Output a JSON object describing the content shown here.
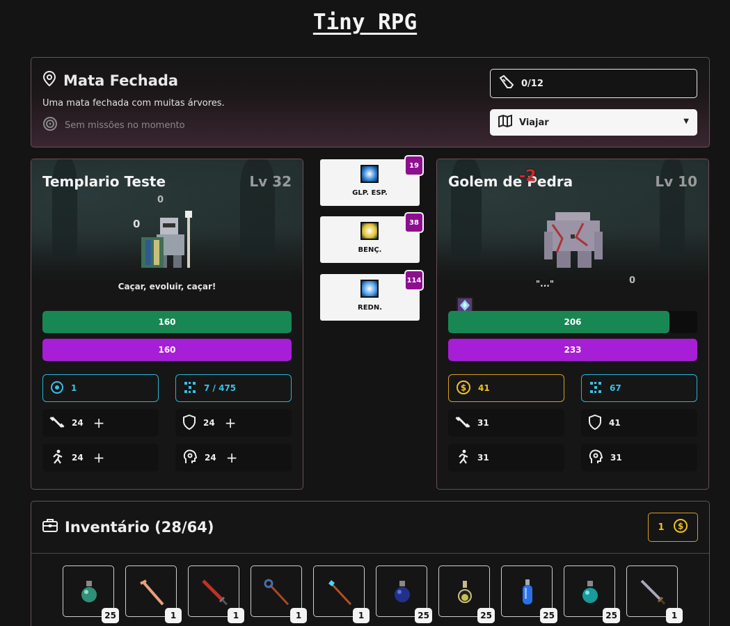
{
  "app": {
    "title": "Tiny RPG"
  },
  "location": {
    "name": "Mata Fechada",
    "description": "Uma mata fechada com muitas árvores.",
    "mission_status": "Sem missões no momento",
    "steps": "0/12",
    "travel_label": "Viajar",
    "icons": {
      "location": "map-pin-icon",
      "mission": "target-icon",
      "steps": "boot-icon",
      "travel": "map-icon"
    }
  },
  "player": {
    "name": "Templario Teste",
    "level": "Lv 32",
    "quote": "Caçar, evoluir, caçar!",
    "float_a": "0",
    "float_b": "0",
    "hp": {
      "label": "160",
      "fraction": 1.0
    },
    "mp": {
      "label": "160",
      "fraction": 1.0
    },
    "points": "1",
    "xp": "7 / 475",
    "strength": "24",
    "defense": "24",
    "agility": "24",
    "magic": "24",
    "plus": "+"
  },
  "skills": [
    {
      "label": "GLP. ESP.",
      "cost": "19",
      "color": "#2a7fd4"
    },
    {
      "label": "BENÇ.",
      "cost": "38",
      "color": "#e0c22a"
    },
    {
      "label": "REDN.",
      "cost": "114",
      "color": "#4a9be8"
    }
  ],
  "enemy": {
    "name": "Golem de Pedra",
    "level": "Lv 10",
    "quote": "\"...\"",
    "damage_float": "-2",
    "float_a": "0",
    "hp": {
      "label": "206",
      "fraction": 0.888
    },
    "mp": {
      "label": "233",
      "fraction": 1.0
    },
    "gold": "41",
    "xp": "67",
    "strength": "31",
    "defense": "41",
    "agility": "31",
    "magic": "31"
  },
  "inventory": {
    "title": "Inventário (28/64)",
    "gold": "1",
    "items": [
      {
        "name": "potion-green-small",
        "qty": "25"
      },
      {
        "name": "staff-wood",
        "qty": "1"
      },
      {
        "name": "sword-red",
        "qty": "1"
      },
      {
        "name": "staff-orb",
        "qty": "1"
      },
      {
        "name": "staff-crystal",
        "qty": "1"
      },
      {
        "name": "potion-blue",
        "qty": "25"
      },
      {
        "name": "potion-yellow",
        "qty": "25"
      },
      {
        "name": "potion-tall-blue",
        "qty": "25"
      },
      {
        "name": "potion-teal",
        "qty": "25"
      },
      {
        "name": "sword-steel",
        "qty": "1"
      }
    ]
  },
  "colors": {
    "hp": "#198754",
    "mp": "#a61ed6",
    "accent_blue": "#28b4d6",
    "gold": "#f2c21a",
    "border": "#6a4f55"
  }
}
